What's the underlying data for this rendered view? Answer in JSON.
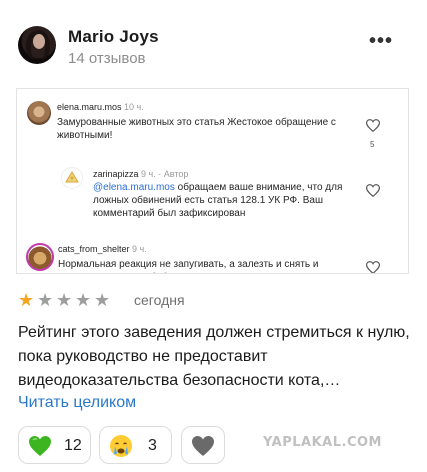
{
  "author": {
    "name": "Mario Joys",
    "reviews": "14 отзывов"
  },
  "embedded_comments": [
    {
      "user": "elena.maru.mos",
      "time": "10 ч.",
      "text": "Замурованные животных это статья Жестокое обращение с животными!",
      "likes": "5"
    },
    {
      "user": "zarinapizza",
      "time": "9 ч. · Автор",
      "mention": "@elena.maru.mos",
      "text": " обращаем ваше внимание, что для ложных обвинений есть статья 128.1 УК РФ. Ваш комментарий был зафиксирован"
    },
    {
      "user": "cats_from_shelter",
      "time": "9 ч.",
      "text": "Нормальная реакция не запугивать, а залезть и снять и помочь, маленькие бабушки - а не так. Вы же"
    }
  ],
  "rating": {
    "value": 1,
    "max": 5,
    "filled_color": "#f5a623",
    "empty_color": "#9e9e9e"
  },
  "review": {
    "date": "сегодня",
    "text": "Рейтинг этого заведения должен стремиться к нулю, пока руководство не предоставит видеодоказательства безопасности кота,…",
    "read_more": "Читать целиком"
  },
  "reactions": [
    {
      "icon": "green-heart-icon",
      "count": "12"
    },
    {
      "icon": "crying-face-icon",
      "count": "3"
    },
    {
      "icon": "heart-icon",
      "count": ""
    }
  ],
  "watermark": "YAPLAKAL.COM"
}
